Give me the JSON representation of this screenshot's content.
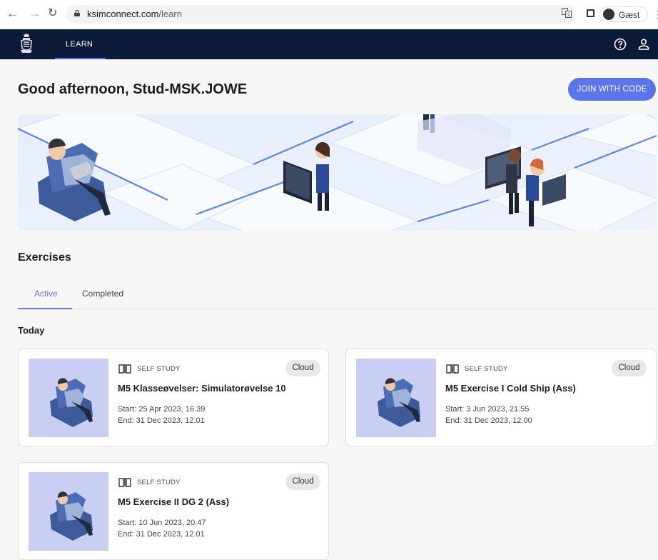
{
  "browser": {
    "url_host": "ksimconnect.com",
    "url_path": "/learn",
    "profile_name": "Gæst"
  },
  "appbar": {
    "nav_label": "LEARN"
  },
  "page": {
    "greeting": "Good afternoon, Stud-MSK.JOWE",
    "join_label": "JOIN WITH CODE",
    "section_title": "Exercises",
    "tabs": [
      {
        "label": "Active",
        "active": true
      },
      {
        "label": "Completed",
        "active": false
      }
    ],
    "group_label": "Today"
  },
  "exercises": [
    {
      "kind": "SELF STUDY",
      "badge": "Cloud",
      "title": "M5 Klasseøvelser: Simulatorøvelse 10",
      "start": "Start: 25 Apr 2023, 16.39",
      "end": "End: 31 Dec 2023, 12.01"
    },
    {
      "kind": "SELF STUDY",
      "badge": "Cloud",
      "title": "M5 Exercise I Cold Ship (Ass)",
      "start": "Start: 3 Jun 2023, 21.55",
      "end": "End: 31 Dec 2023, 12.00"
    },
    {
      "kind": "SELF STUDY",
      "badge": "Cloud",
      "title": "M5 Exercise II DG 2 (Ass)",
      "start": "Start: 10 Jun 2023, 20.47",
      "end": "End: 31 Dec 2023, 12.01"
    }
  ],
  "colors": {
    "accent": "#5a76e8",
    "appbar": "#0a1a38",
    "thumb_bg": "#c9cff3"
  },
  "icons": [
    "back-icon",
    "forward-icon",
    "reload-icon",
    "lock-icon",
    "translate-icon",
    "side-panel-icon",
    "profile-icon",
    "menu-icon",
    "logo-icon",
    "help-icon",
    "user-icon",
    "book-icon"
  ]
}
